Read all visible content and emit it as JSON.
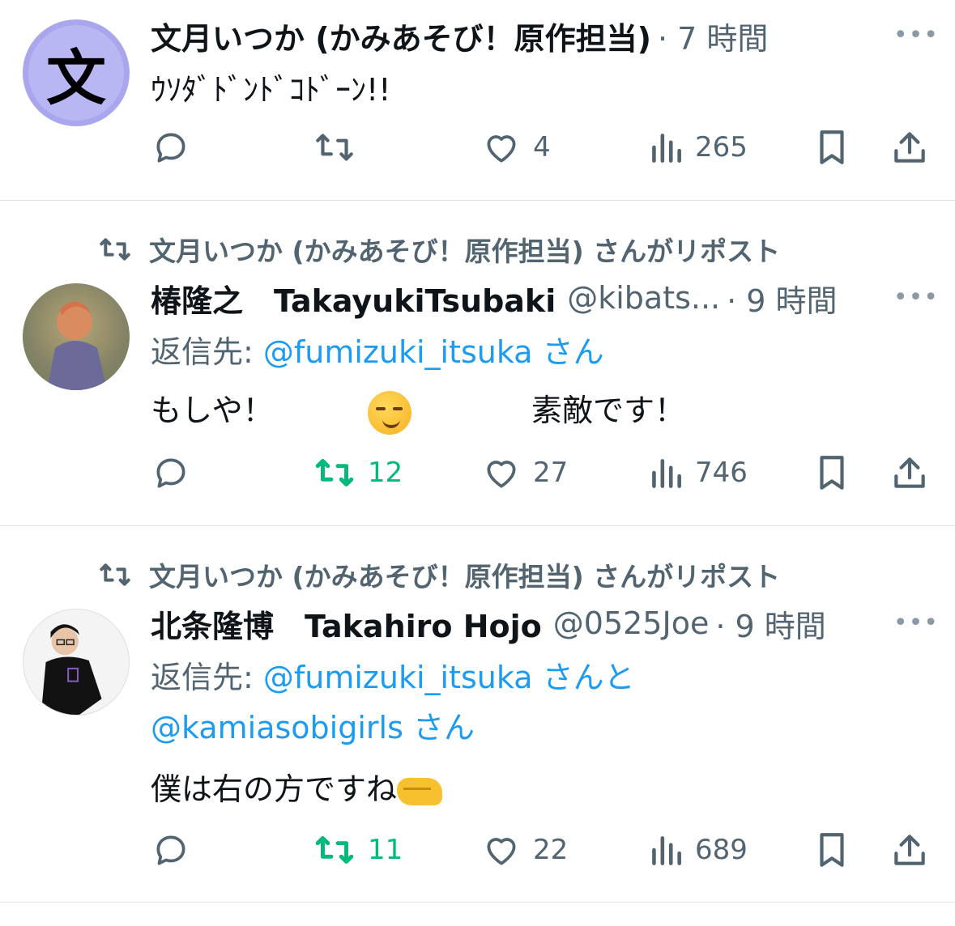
{
  "tweets": [
    {
      "repost_label": "",
      "author": "文月いつか (かみあそび！原作担当)",
      "handle": "",
      "time": "· 7 時間",
      "avatar_letter": "文",
      "reply_prefix": "",
      "reply_handles": [],
      "text": "ｳｿﾀﾞﾄﾞﾝﾄﾞｺﾄﾞｰﾝ!!",
      "replies": "",
      "reposts": "",
      "likes": "4",
      "views": "265",
      "reposted": false
    },
    {
      "repost_label": "文月いつか (かみあそび！原作担当) さんがリポスト",
      "author": "椿隆之　TakayukiTsubaki",
      "handle": "@kibats...",
      "time": "· 9 時間",
      "reply_prefix": "返信先: ",
      "reply_handles": [
        "@fumizuki_itsuka",
        " さん"
      ],
      "text_parts": [
        "もしや！",
        "素敵です！"
      ],
      "emoji": "smirking-face-emoji",
      "replies": "",
      "reposts": "12",
      "likes": "27",
      "views": "746",
      "reposted": true
    },
    {
      "repost_label": "文月いつか (かみあそび！原作担当) さんがリポスト",
      "author": "北条隆博　Takahiro Hojo",
      "handle": "@0525Joe",
      "time": "· 9 時間",
      "reply_prefix": "返信先: ",
      "reply_handles": [
        "@fumizuki_itsuka",
        " さんと",
        "@kamiasobigirls",
        " さん"
      ],
      "text": "僕は右の方ですね",
      "emoji": "right-facing-fist-emoji",
      "replies": "",
      "reposts": "11",
      "likes": "22",
      "views": "689",
      "reposted": true
    }
  ],
  "more_icon": "•••",
  "colors": {
    "accent_link": "#1d9bf0",
    "repost_green": "#00ba7c",
    "secondary_text": "#536471",
    "avatar_purple": "#a9a6ee"
  }
}
